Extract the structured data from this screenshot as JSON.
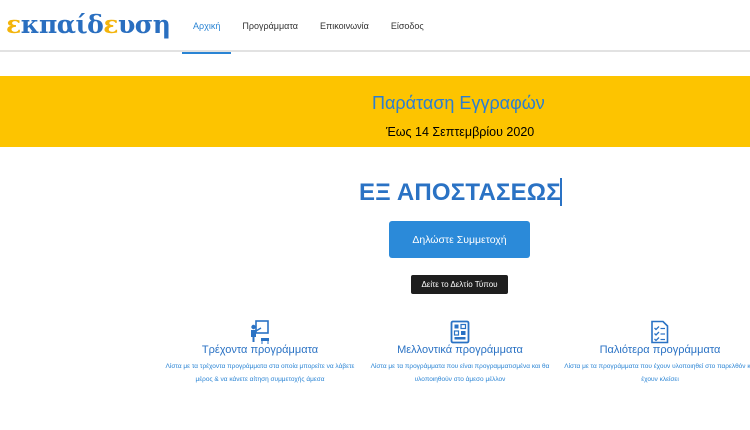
{
  "logo": {
    "part1": "ε",
    "part2": "κπαίδ",
    "part3": "ε",
    "part4": "υση"
  },
  "nav": {
    "items": [
      {
        "label": "Αρχική"
      },
      {
        "label": "Προγράμματα"
      },
      {
        "label": "Επικοινωνία"
      },
      {
        "label": "Είσοδος"
      }
    ],
    "active_index": 0
  },
  "banner": {
    "title": "Παράταση Εγγραφών",
    "subtitle": "Έως 14 Σεπτεμβρίου 2020"
  },
  "headline": "ΕΞ ΑΠΟΣΤΑΣΕΩΣ",
  "buttons": {
    "primary_label": "Δηλώστε Συμμετοχή",
    "press_label": "Δείτε το Δελτίο Τύπου"
  },
  "features": [
    {
      "icon": "teacher-board-icon",
      "title": "Τρέχοντα προγράμματα",
      "description": "Λίστα με τα τρέχοντα προγράμματα στα οποία μπορείτε να λάβετε μέρος & να κάνετε αίτηση συμμετοχής άμεσα"
    },
    {
      "icon": "planner-board-icon",
      "title": "Μελλοντικά προγράμματα",
      "description": "Λίστα με τα προγράμματα που είναι προγραμματισμένα και θα υλοποιηθούν στο άμεσο μέλλον"
    },
    {
      "icon": "checklist-icon",
      "title": "Παλιότερα προγράμματα",
      "description": "Λίστα με τα προγράμματα που έχουν υλοποιηθεί στο παρελθόν και έχουν κλείσει"
    }
  ],
  "colors": {
    "brand_blue": "#2a72c4",
    "accent_blue": "#2b8ad9",
    "banner_yellow": "#fdc400",
    "logo_yellow": "#f3b40b"
  }
}
